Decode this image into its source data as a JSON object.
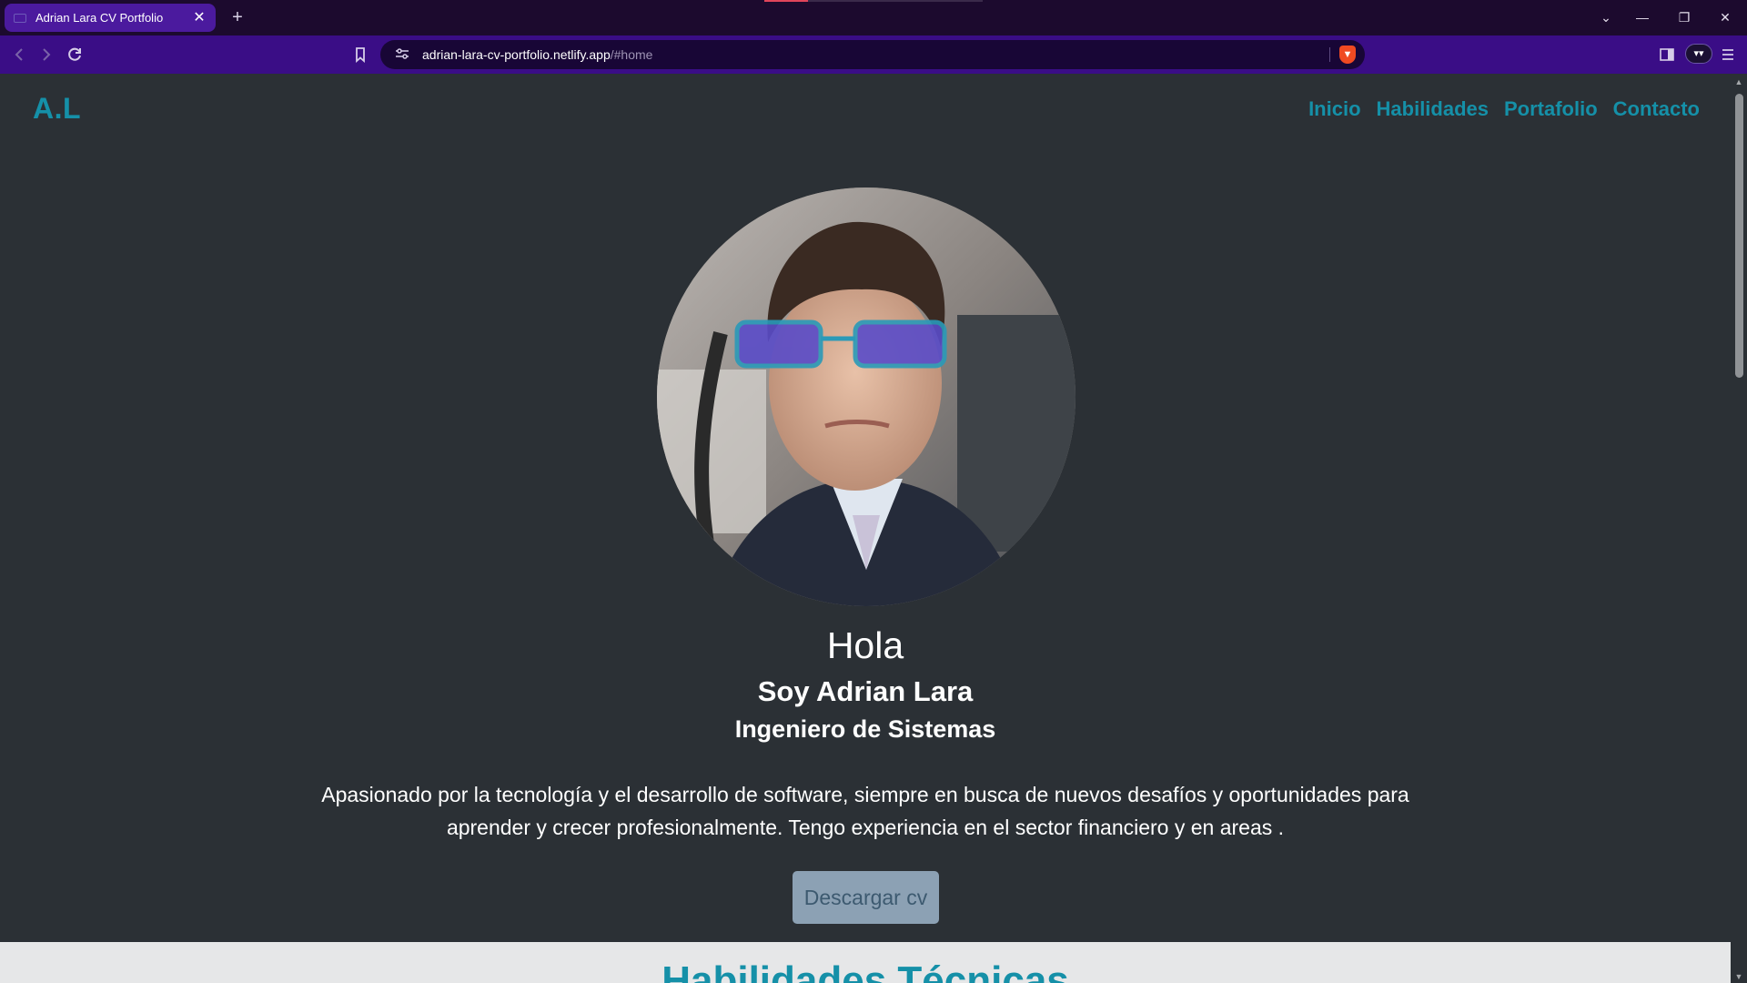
{
  "browser": {
    "tab_title": "Adrian Lara CV Portfolio",
    "tab_close": "✕",
    "new_tab": "+",
    "url_host": "adrian-lara-cv-portfolio.netlify.app",
    "url_path": "/#home",
    "window_controls": [
      "⌄",
      "—",
      "❐",
      "✕"
    ],
    "icons": [
      "back-icon",
      "forward-icon",
      "reload-icon",
      "bookmark-icon",
      "site-settings-icon",
      "brave-shields-icon",
      "sidebar-icon",
      "wallet-icon",
      "menu-icon"
    ]
  },
  "site": {
    "brand": "A.L",
    "nav": [
      "Inicio",
      "Habilidades",
      "Portafolio",
      "Contacto"
    ]
  },
  "hero": {
    "greeting": "Hola",
    "name": "Soy Adrian Lara",
    "role": "Ingeniero de Sistemas",
    "bio": "Apasionado por la tecnología y el desarrollo de software, siempre en busca de nuevos desafíos y oportunidades para aprender y crecer profesionalmente. Tengo experiencia en el sector financiero y en areas .",
    "cv_button": "Descargar cv"
  },
  "skills": {
    "title": "Habilidades Técnicas"
  },
  "colors": {
    "accent": "#1590a8",
    "page_bg": "#2b3035",
    "button_bg": "#8ca1b4",
    "tab_active": "#4b1a9e",
    "toolbar": "#3a0d86"
  }
}
